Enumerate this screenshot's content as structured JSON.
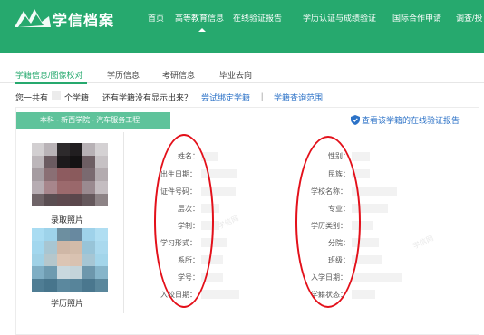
{
  "header": {
    "site_name": "学信档案",
    "nav": [
      "首页",
      "高等教育信息",
      "在线验证报告",
      "学历认证与成绩验证",
      "国际合作申请",
      "调查/投"
    ],
    "bg": "#26a96e"
  },
  "tabs": [
    "学籍信息/图像校对",
    "学历信息",
    "考研信息",
    "毕业去向"
  ],
  "summary": {
    "prefix": "您一共有",
    "suffix": "个学籍",
    "question": "还有学籍没有显示出来？",
    "bind_link": "尝试绑定学籍",
    "divider": "|",
    "scope_link": "学籍查询范围"
  },
  "panel": {
    "label": "本科 - 新西学院 - 汽车服务工程",
    "report_link": "查看该学籍的在线验证报告",
    "photo1_caption": "录取照片",
    "photo2_caption": "学历照片"
  },
  "fields_left": [
    "姓名：",
    "出生日期：",
    "证件号码：",
    "层次：",
    "学制：",
    "学习形式：",
    "系所：",
    "学号：",
    "入校日期："
  ],
  "fields_right": [
    "性别：",
    "民族：",
    "学校名称：",
    "专业：",
    "学历类别：",
    "分院：",
    "班级：",
    "入学日期：",
    "学籍状态："
  ],
  "watermark": "学信网",
  "colors": {
    "accent": "#26a96e",
    "link": "#2c72c7",
    "annotation": "#e3101a"
  }
}
